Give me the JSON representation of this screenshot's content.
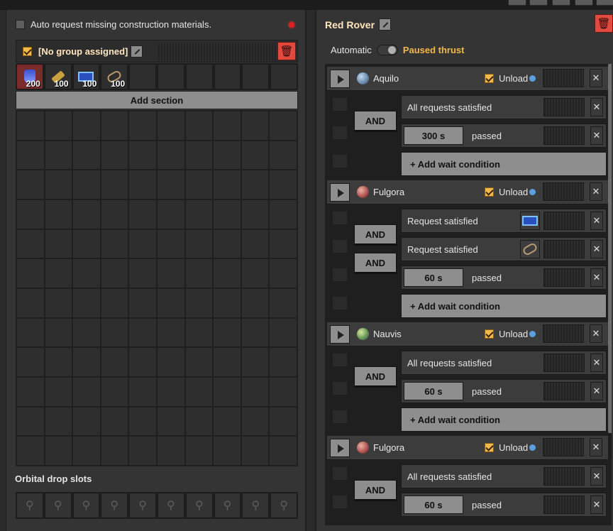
{
  "left": {
    "auto_request_label": "Auto request missing construction materials.",
    "group_name": "[No group assigned]",
    "slots": [
      {
        "icon": "science-pack-icon",
        "count": "200"
      },
      {
        "icon": "battery-icon",
        "count": "100"
      },
      {
        "icon": "circuit-icon",
        "count": "100"
      },
      {
        "icon": "chain-icon",
        "count": "100"
      }
    ],
    "add_section_label": "Add section",
    "orbital_title": "Orbital drop slots"
  },
  "right": {
    "title": "Red Rover",
    "automatic_label": "Automatic",
    "status_label": "Paused thrust",
    "stations": [
      {
        "name": "Aquilo",
        "unload_label": "Unload",
        "planet_color": "#6a88a8"
      },
      {
        "name": "Fulgora",
        "unload_label": "Unload",
        "planet_color": "#a85050"
      },
      {
        "name": "Nauvis",
        "unload_label": "Unload",
        "planet_color": "#6a9a58"
      },
      {
        "name": "Fulgora",
        "unload_label": "Unload",
        "planet_color": "#a85050"
      }
    ],
    "and_label": "AND",
    "add_wait_label": "+ Add wait condition",
    "passed_label": "passed",
    "cond_all": "All requests satisfied",
    "cond_req": "Request satisfied",
    "time_300": "300 s",
    "time_60": "60 s"
  }
}
